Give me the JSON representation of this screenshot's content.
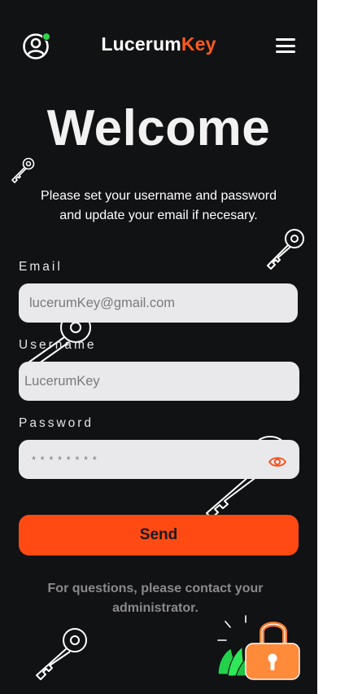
{
  "app": {
    "brand_prefix": "Lucerum",
    "brand_accent": "Key",
    "accent_color": "#ff5a1f",
    "status_color": "#2fd24a"
  },
  "header": {
    "avatar_icon": "user-circle-icon",
    "menu_icon": "hamburger-menu-icon"
  },
  "main": {
    "title": "Welcome",
    "subtitle": "Please set your  username and password and update your email if necesary."
  },
  "form": {
    "email_label": "Email",
    "email_value": "lucerumKey@gmail.com",
    "username_label": "Username",
    "username_value": "LucerumKey",
    "password_label": "Password",
    "password_value": "* * * * * * * *",
    "password_toggle_icon": "eye-icon",
    "send_label": "Send"
  },
  "footer": {
    "note": "For questions, please contact your administrator."
  }
}
